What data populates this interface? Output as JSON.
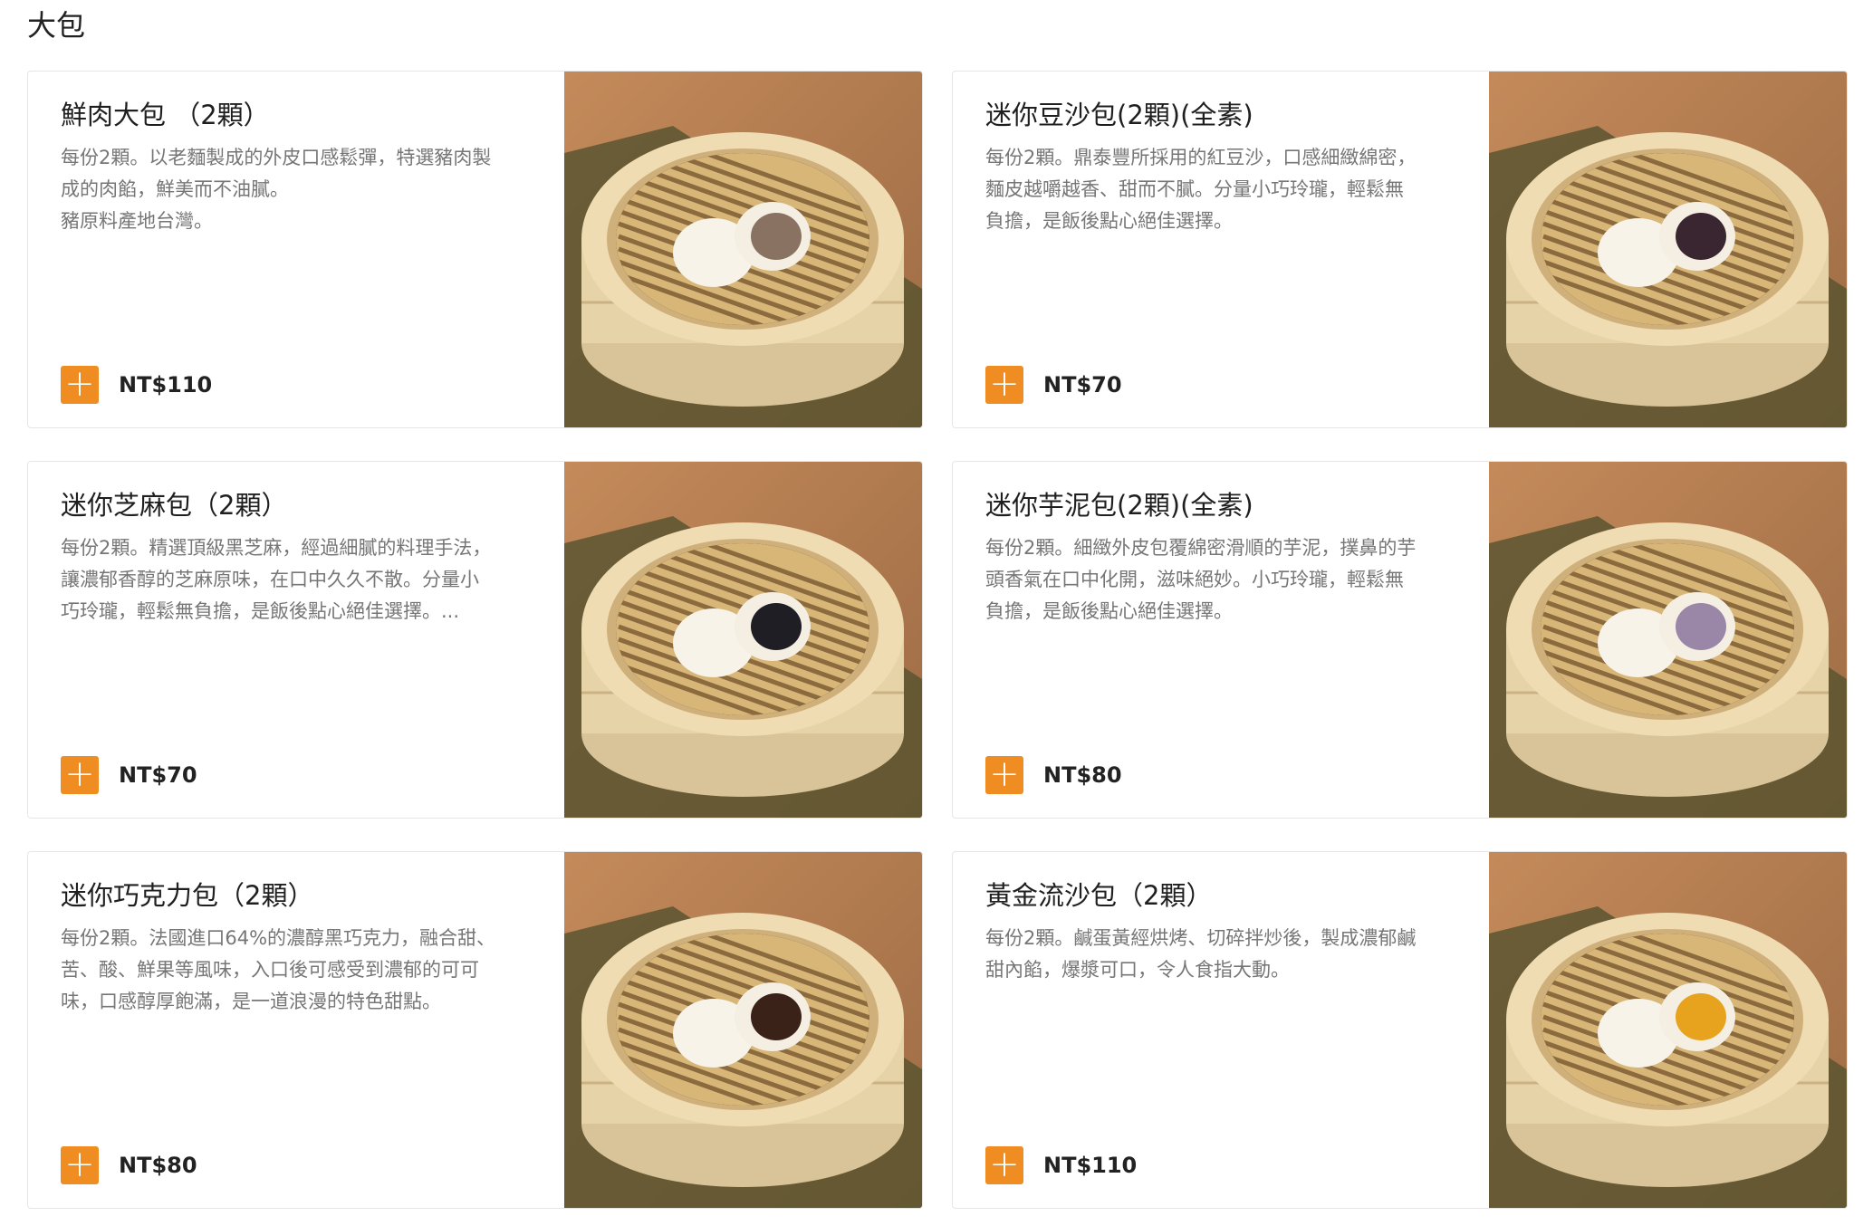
{
  "section": {
    "title": "大包"
  },
  "products": [
    {
      "name": "鮮肉大包 （2顆）",
      "desc": "每份2顆。以老麵製成的外皮口感鬆彈，特選豬肉製\n成的肉餡，鮮美而不油膩。\n豬原料產地台灣。",
      "price": "NT$110",
      "filling_color": "#8a7262"
    },
    {
      "name": "迷你豆沙包(2顆)(全素)",
      "desc": "每份2顆。鼎泰豐所採用的紅豆沙，口感細緻綿密，\n麵皮越嚼越香、甜而不膩。分量小巧玲瓏，輕鬆無\n負擔，是飯後點心絕佳選擇。",
      "price": "NT$70",
      "filling_color": "#3a2630"
    },
    {
      "name": "迷你芝麻包（2顆）",
      "desc": "每份2顆。精選頂級黑芝麻，經過細膩的料理手法，\n讓濃郁香醇的芝麻原味，在口中久久不散。分量小\n巧玲瓏，輕鬆無負擔，是飯後點心絕佳選擇。...",
      "price": "NT$70",
      "filling_color": "#1e1e24"
    },
    {
      "name": "迷你芋泥包(2顆)(全素)",
      "desc": "每份2顆。細緻外皮包覆綿密滑順的芋泥，撲鼻的芋\n頭香氣在口中化開，滋味絕妙。小巧玲瓏，輕鬆無\n負擔，是飯後點心絕佳選擇。",
      "price": "NT$80",
      "filling_color": "#9a86a6"
    },
    {
      "name": "迷你巧克力包（2顆）",
      "desc": "每份2顆。法國進口64%的濃醇黑巧克力，融合甜、\n苦、酸、鮮果等風味，入口後可感受到濃郁的可可\n味，口感醇厚飽滿，是一道浪漫的特色甜點。",
      "price": "NT$80",
      "filling_color": "#3b2219"
    },
    {
      "name": "黃金流沙包（2顆）",
      "desc": "每份2顆。鹹蛋黃經烘烤、切碎拌炒後，製成濃郁鹹\n甜內餡，爆漿可口，令人食指大動。",
      "price": "NT$110",
      "filling_color": "#e7a21e"
    }
  ],
  "colors": {
    "accent": "#f08d22",
    "text_muted": "#767676"
  },
  "icons": {
    "add": "plus-icon"
  }
}
